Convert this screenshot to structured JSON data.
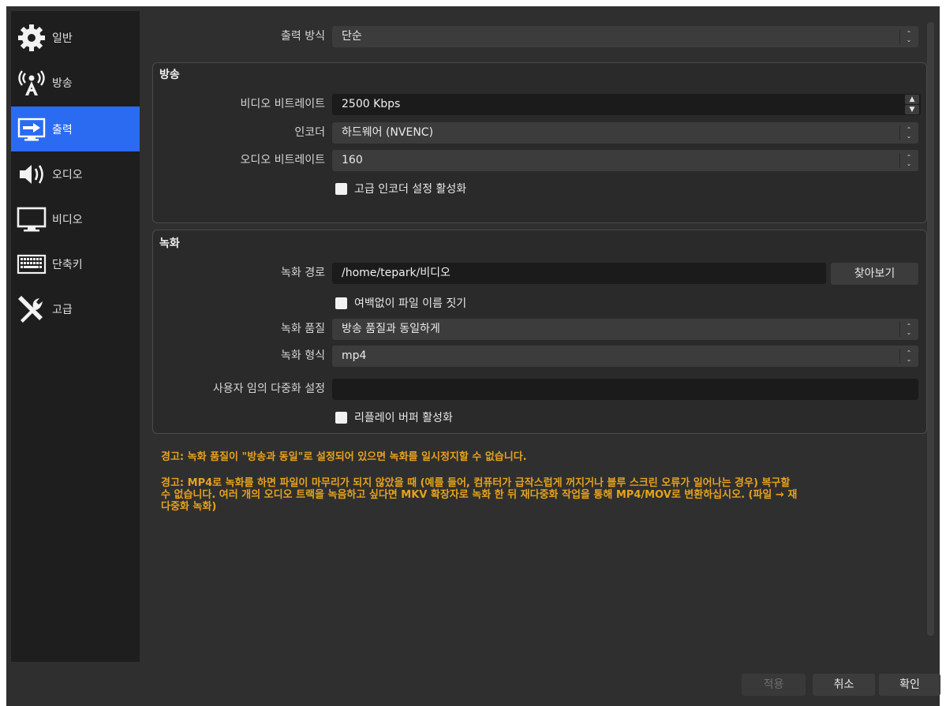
{
  "sidebar": {
    "items": [
      {
        "label": "일반",
        "icon": "gear-icon"
      },
      {
        "label": "방송",
        "icon": "broadcast-antenna-icon"
      },
      {
        "label": "출력",
        "icon": "output-monitor-icon"
      },
      {
        "label": "오디오",
        "icon": "speaker-icon"
      },
      {
        "label": "비디오",
        "icon": "monitor-icon"
      },
      {
        "label": "단축키",
        "icon": "keyboard-icon"
      },
      {
        "label": "고급",
        "icon": "tools-icon"
      }
    ],
    "active_index": 2,
    "active_color": "#2a6bf2"
  },
  "output_mode": {
    "label": "출력 방식",
    "value": "단순"
  },
  "streaming": {
    "title": "방송",
    "video_bitrate": {
      "label": "비디오 비트레이트",
      "value": "2500 Kbps"
    },
    "encoder": {
      "label": "인코더",
      "value": "하드웨어 (NVENC)"
    },
    "audio_bitrate": {
      "label": "오디오 비트레이트",
      "value": "160"
    },
    "advanced_encoder": {
      "label": "고급 인코더 설정 활성화",
      "checked": false
    }
  },
  "recording": {
    "title": "녹화",
    "path": {
      "label": "녹화 경로",
      "value": "/home/tepark/비디오"
    },
    "browse_label": "찾아보기",
    "no_space": {
      "label": "여백없이 파일 이름 짓기",
      "checked": false
    },
    "quality": {
      "label": "녹화 품질",
      "value": "방송 품질과 동일하게"
    },
    "format": {
      "label": "녹화 형식",
      "value": "mp4"
    },
    "muxer": {
      "label": "사용자 임의 다중화 설정",
      "value": ""
    },
    "replay_buffer": {
      "label": "리플레이 버퍼 활성화",
      "checked": false
    }
  },
  "warnings": [
    "경고: 녹화 품질이 \"방송과 동일\"로 설정되어 있으면 녹화를 일시정지할 수 없습니다.",
    "경고: MP4로 녹화를 하면 파일이 마무리가 되지 않았을 때 (예를 들어, 컴퓨터가 급작스럽게 꺼지거나 블루 스크린 오류가 일어나는 경우) 복구할",
    "수 없습니다. 여러 개의 오디오 트랙을 녹음하고 싶다면 MKV 확장자로 녹화 한 뒤 재다중화 작업을 통해 MP4/MOV로 변환하십시오. (파일 → 재",
    "다중화 녹화)"
  ],
  "warning_color": "#e6a21c",
  "footer": {
    "apply": "적용",
    "cancel": "취소",
    "ok": "확인"
  },
  "spin_up": "▲",
  "spin_down": "▼",
  "combo_arrow_up": "⌃",
  "combo_arrow_down": "⌄"
}
